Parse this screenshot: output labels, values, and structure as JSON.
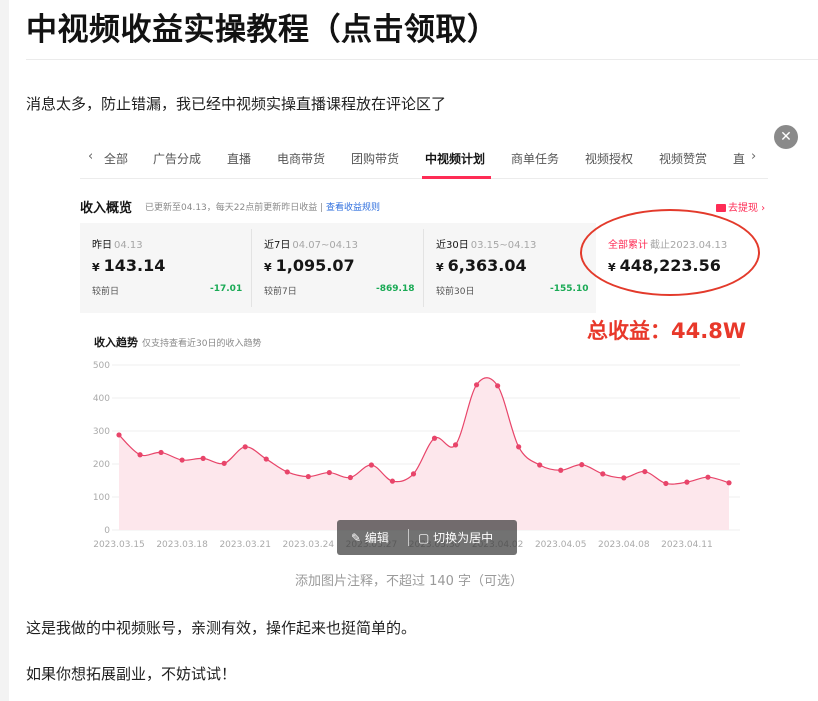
{
  "article": {
    "title": "中视频收益实操教程（点击领取）",
    "paragraph1": "消息太多，防止错漏，我已经中视频实操直播课程放在评论区了",
    "paragraph2": "这是我做的中视频账号，亲测有效，操作起来也挺简单的。",
    "paragraph3": "如果你想拓展副业，不妨试试！",
    "caption_placeholder": "添加图片注释，不超过 140 字（可选）",
    "close_symbol": "✕"
  },
  "image_toolbar": {
    "edit_label": "编辑",
    "center_label": "切换为居中"
  },
  "screenshot": {
    "tabs": [
      "全部",
      "广告分成",
      "直播",
      "电商带货",
      "团购带货",
      "中视频计划",
      "商单任务",
      "视频授权",
      "视频赞赏",
      "直"
    ],
    "active_tab": "中视频计划",
    "overview": {
      "title": "收入概览",
      "note": "已更新至04.13，每天22点前更新昨日收益 | ",
      "link": "查看收益规则",
      "withdraw": "去提现 ›"
    },
    "cards": [
      {
        "label": "昨日",
        "date": "04.13",
        "currency": "¥",
        "value": "143.14",
        "compare_label": "较前日",
        "delta": "-17.01"
      },
      {
        "label": "近7日",
        "date": "04.07~04.13",
        "currency": "¥",
        "value": "1,095.07",
        "compare_label": "较前7日",
        "delta": "-869.18"
      },
      {
        "label": "近30日",
        "date": "03.15~04.13",
        "currency": "¥",
        "value": "6,363.04",
        "compare_label": "较前30日",
        "delta": "-155.10"
      },
      {
        "label": "全部累计",
        "date": "截止2023.04.13",
        "currency": "¥",
        "value": "448,223.56"
      }
    ],
    "annotation": "总收益：44.8W",
    "trend": {
      "title": "收入趋势",
      "note": "仅支持查看近30日的收入趋势"
    }
  },
  "chart_data": {
    "type": "area",
    "title": "收入趋势",
    "xlabel": "",
    "ylabel": "",
    "ylim": [
      0,
      500
    ],
    "yticks": [
      0,
      100,
      200,
      300,
      400,
      500
    ],
    "xtick_labels": [
      "2023.03.15",
      "2023.03.18",
      "2023.03.21",
      "2023.03.24",
      "2023.03.27",
      "2023.03.30",
      "2023.04.02",
      "2023.04.05",
      "2023.04.08",
      "2023.04.11"
    ],
    "x": [
      "03.15",
      "03.16",
      "03.17",
      "03.18",
      "03.19",
      "03.20",
      "03.21",
      "03.22",
      "03.23",
      "03.24",
      "03.25",
      "03.26",
      "03.27",
      "03.28",
      "03.29",
      "03.30",
      "03.31",
      "04.01",
      "04.02",
      "04.03",
      "04.04",
      "04.05",
      "04.06",
      "04.07",
      "04.08",
      "04.09",
      "04.10",
      "04.11",
      "04.12",
      "04.13"
    ],
    "values": [
      288,
      228,
      235,
      212,
      217,
      202,
      252,
      215,
      176,
      162,
      174,
      159,
      197,
      148,
      170,
      278,
      258,
      440,
      437,
      252,
      197,
      181,
      198,
      170,
      158,
      177,
      141,
      145,
      160,
      143
    ],
    "line_color": "#e8456a",
    "fill_color": "#fde7ec",
    "grid": true
  }
}
